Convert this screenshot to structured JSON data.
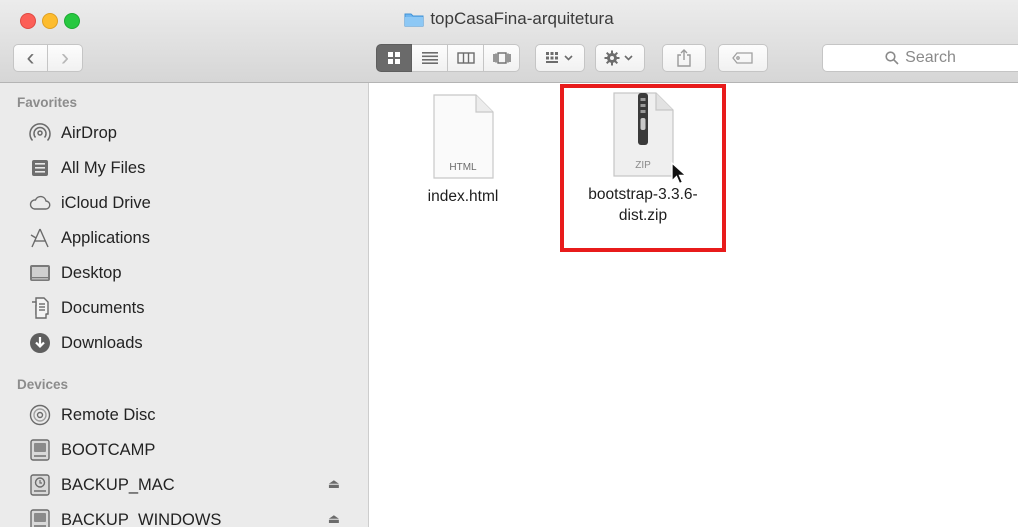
{
  "window": {
    "title": "topCasaFina-arquitetura"
  },
  "toolbar": {
    "back_label": "‹",
    "forward_label": "›",
    "view_icons": [
      "icon-view-icon",
      "list-view-icon",
      "column-view-icon",
      "coverflow-view-icon"
    ],
    "arrange_icon": "arrange-menu-icon",
    "action_icon": "gear-icon",
    "share_icon": "share-icon",
    "tags_icon": "tag-icon",
    "search_placeholder": "Search"
  },
  "sidebar": {
    "favorites_header": "Favorites",
    "favorites": [
      {
        "label": "AirDrop",
        "icon": "airdrop-icon"
      },
      {
        "label": "All My Files",
        "icon": "all-files-icon"
      },
      {
        "label": "iCloud Drive",
        "icon": "cloud-icon"
      },
      {
        "label": "Applications",
        "icon": "applications-icon"
      },
      {
        "label": "Desktop",
        "icon": "desktop-icon"
      },
      {
        "label": "Documents",
        "icon": "documents-icon"
      },
      {
        "label": "Downloads",
        "icon": "downloads-icon"
      }
    ],
    "devices_header": "Devices",
    "devices": [
      {
        "label": "Remote Disc",
        "icon": "disc-icon"
      },
      {
        "label": "BOOTCAMP",
        "icon": "drive-icon"
      },
      {
        "label": "BACKUP_MAC",
        "icon": "backup-drive-icon",
        "eject": "⏏"
      },
      {
        "label": "BACKUP_WINDOWS",
        "icon": "drive-icon",
        "eject": "⏏"
      }
    ]
  },
  "files": [
    {
      "name": "index.html",
      "badge": "HTML"
    },
    {
      "name_line1": "bootstrap-3.3.6-",
      "name_line2": "dist.zip",
      "badge": "ZIP",
      "highlighted": true
    }
  ],
  "colors": {
    "highlight": "#e81b1b",
    "selected_view": "#6a6a6a"
  }
}
